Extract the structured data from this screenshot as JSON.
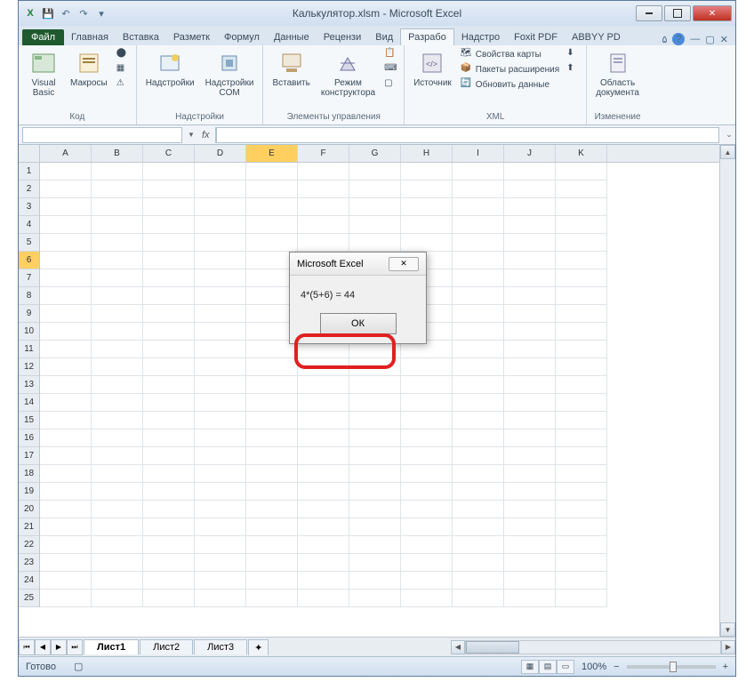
{
  "titlebar": {
    "title": "Калькулятор.xlsm  -  Microsoft Excel"
  },
  "tabs": {
    "file": "Файл",
    "items": [
      "Главная",
      "Вставка",
      "Разметк",
      "Формул",
      "Данные",
      "Рецензи",
      "Вид",
      "Разрабо",
      "Надстро",
      "Foxit PDF",
      "ABBYY PD"
    ],
    "active_index": 7
  },
  "ribbon": {
    "groups": [
      {
        "label": "Код",
        "big": [
          {
            "name": "visual-basic",
            "label": "Visual\nBasic"
          },
          {
            "name": "macros",
            "label": "Макросы"
          }
        ],
        "smalls": []
      },
      {
        "label": "Надстройки",
        "big": [
          {
            "name": "addins",
            "label": "Надстройки"
          },
          {
            "name": "com-addins",
            "label": "Надстройки\nCOM"
          }
        ],
        "smalls": []
      },
      {
        "label": "Элементы управления",
        "big": [
          {
            "name": "insert",
            "label": "Вставить"
          },
          {
            "name": "design-mode",
            "label": "Режим\nконструктора"
          }
        ],
        "smalls": []
      },
      {
        "label": "XML",
        "big": [
          {
            "name": "source",
            "label": "Источник"
          }
        ],
        "smalls": [
          {
            "name": "map-properties",
            "label": "Свойства карты"
          },
          {
            "name": "expansion-packs",
            "label": "Пакеты расширения"
          },
          {
            "name": "refresh-data",
            "label": "Обновить данные"
          }
        ]
      },
      {
        "label": "Изменение",
        "big": [
          {
            "name": "document-panel",
            "label": "Область\nдокумента"
          }
        ],
        "smalls": []
      }
    ]
  },
  "formula_bar": {
    "namebox": "",
    "fx_label": "fx",
    "formula": ""
  },
  "grid": {
    "columns": [
      "A",
      "B",
      "C",
      "D",
      "E",
      "F",
      "G",
      "H",
      "I",
      "J",
      "K"
    ],
    "rows": [
      1,
      2,
      3,
      4,
      5,
      6,
      7,
      8,
      9,
      10,
      11,
      12,
      13,
      14,
      15,
      16,
      17,
      18,
      19,
      20,
      21,
      22,
      23,
      24,
      25
    ],
    "selected_row": 6,
    "selected_col": "E"
  },
  "sheet_tabs": {
    "items": [
      "Лист1",
      "Лист2",
      "Лист3"
    ],
    "active": 0
  },
  "statusbar": {
    "left": "Готово",
    "zoom": "100%"
  },
  "msgbox": {
    "title": "Microsoft Excel",
    "message": "4*(5+6) = 44",
    "ok": "ОК"
  },
  "icons": {
    "excel": "X",
    "save": "💾",
    "undo": "↶",
    "redo": "↷"
  }
}
